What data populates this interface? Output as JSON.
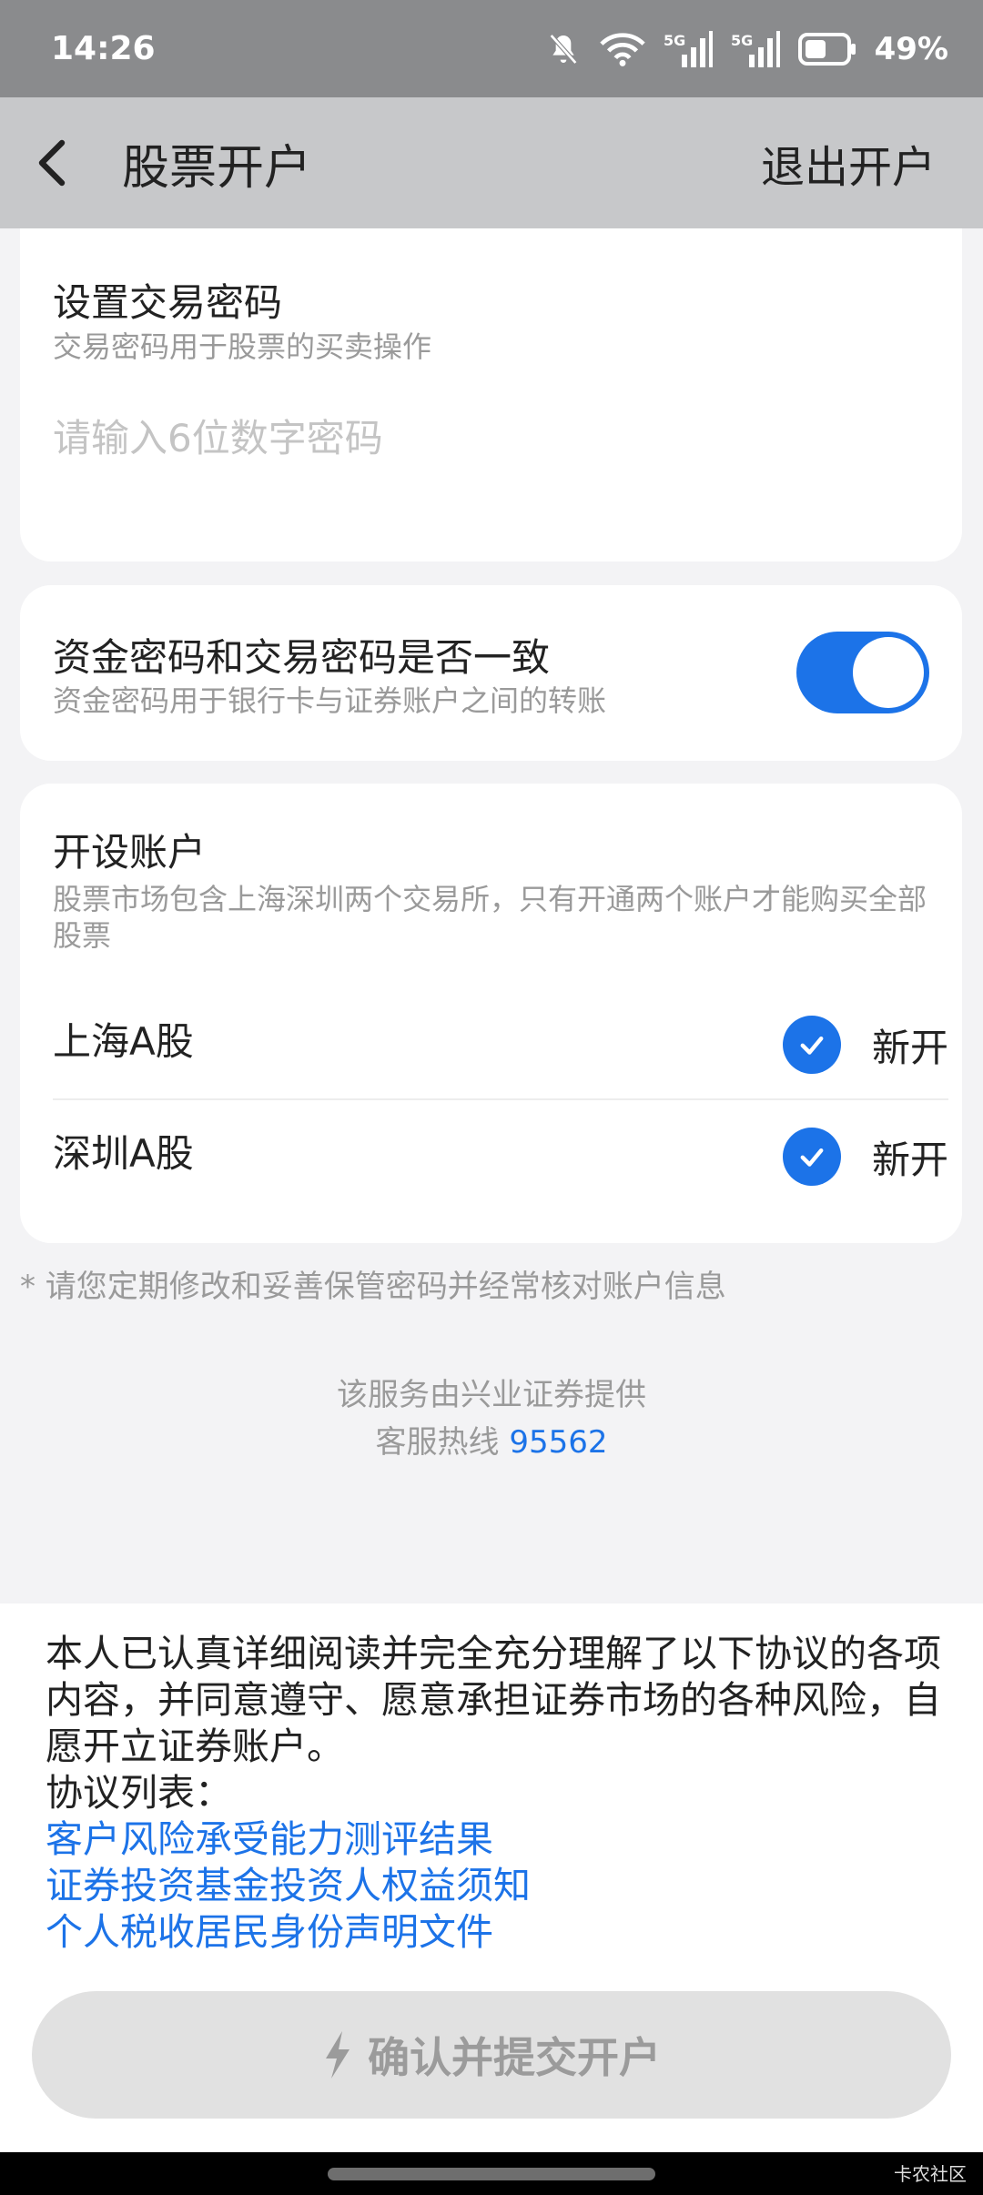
{
  "status_bar": {
    "time": "14:26",
    "network1": "5G",
    "network2": "5G",
    "battery": "49%"
  },
  "nav": {
    "title": "股票开户",
    "exit_label": "退出开户"
  },
  "trade_password": {
    "title": "设置交易密码",
    "description": "交易密码用于股票的买卖操作",
    "placeholder": "请输入6位数字密码"
  },
  "password_match": {
    "title": "资金密码和交易密码是否一致",
    "description": "资金密码用于银行卡与证券账户之间的转账",
    "toggle_on": true
  },
  "open_account": {
    "title": "开设账户",
    "description": "股票市场包含上海深圳两个交易所，只有开通两个账户才能购买全部股票",
    "accounts": [
      {
        "name": "上海A股",
        "status": "新开",
        "checked": true
      },
      {
        "name": "深圳A股",
        "status": "新开",
        "checked": true
      }
    ]
  },
  "notice": "* 请您定期修改和妥善保管密码并经常核对账户信息",
  "provider": "该服务由兴业证券提供",
  "hotline": {
    "label": "客服热线 ",
    "number": "95562"
  },
  "agreement": {
    "text": "本人已认真详细阅读并完全充分理解了以下协议的各项内容，并同意遵守、愿意承担证券市场的各种风险，自愿开立证券账户。",
    "list_label": "协议列表：",
    "links": [
      "客户风险承受能力测评结果",
      "证券投资基金投资人权益须知",
      "个人税收居民身份声明文件"
    ]
  },
  "submit_label": "确认并提交开户",
  "watermark": "卡农社区",
  "colors": {
    "accent": "#1c73e8",
    "status_bar": "#8a8b8d",
    "nav_bar": "#c7c8ca"
  }
}
